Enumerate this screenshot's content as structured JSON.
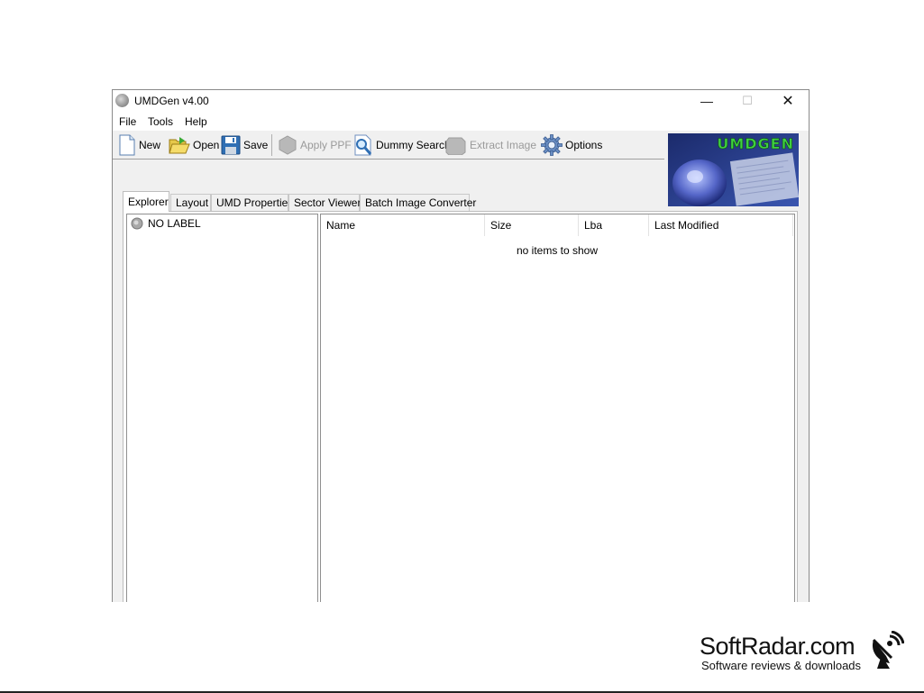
{
  "window": {
    "title": "UMDGen v4.00",
    "controls": {
      "minimize": "—",
      "maximize": "☐",
      "close": "✕"
    }
  },
  "menu": [
    "File",
    "Tools",
    "Help"
  ],
  "toolbar": [
    {
      "label": "New",
      "icon": "new-document-icon",
      "enabled": true
    },
    {
      "label": "Open",
      "icon": "open-folder-icon",
      "enabled": true
    },
    {
      "label": "Save",
      "icon": "save-disk-icon",
      "enabled": true
    },
    {
      "label": "Apply PPF",
      "icon": "apply-ppf-icon",
      "enabled": false
    },
    {
      "label": "Dummy Search",
      "icon": "magnifier-icon",
      "enabled": true
    },
    {
      "label": "Extract Image",
      "icon": "extract-image-icon",
      "enabled": false
    },
    {
      "label": "Options",
      "icon": "gear-icon",
      "enabled": true
    }
  ],
  "logo": {
    "text": "UMDGEN",
    "icon": "umdgen-logo-icon"
  },
  "tabs": [
    {
      "label": "Explorer",
      "active": true
    },
    {
      "label": "Layout",
      "active": false
    },
    {
      "label": "UMD Properties",
      "active": false
    },
    {
      "label": "Sector Viewer",
      "active": false
    },
    {
      "label": "Batch Image Converter",
      "active": false
    }
  ],
  "tree": {
    "items": [
      {
        "label": "NO LABEL",
        "icon": "disc-icon"
      }
    ]
  },
  "list": {
    "columns": [
      "Name",
      "Size",
      "Lba",
      "Last Modified"
    ],
    "empty_message": "no items to show"
  },
  "watermark": {
    "title": "SoftRadar.com",
    "subtitle": "Software reviews & downloads",
    "icon": "satellite-dish-icon"
  },
  "colors": {
    "window_bg": "#f0f0f0",
    "disabled_text": "#9a9a9a",
    "logo_green": "#3fd13f",
    "logo_blue": "#2b3f8f"
  }
}
